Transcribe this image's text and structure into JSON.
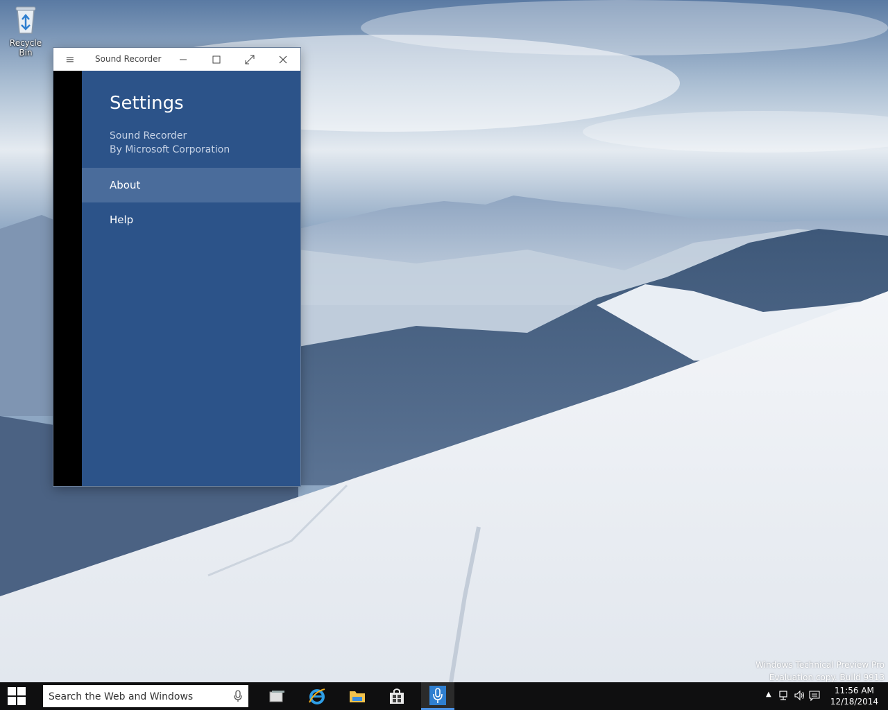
{
  "desktop": {
    "icons": [
      {
        "label": "Recycle Bin",
        "icon": "recycle-bin-icon"
      }
    ],
    "watermark": {
      "line1": "Windows Technical Preview Pro",
      "line2": "Evaluation copy. Build 9913"
    }
  },
  "window": {
    "title": "Sound Recorder",
    "controls": [
      "menu-icon",
      "minimize-icon",
      "maximize-icon",
      "fullscreen-icon",
      "close-icon"
    ],
    "settings": {
      "heading": "Settings",
      "app_name": "Sound Recorder",
      "publisher": "By Microsoft Corporation",
      "items": [
        {
          "label": "About",
          "selected": true
        },
        {
          "label": "Help",
          "selected": false
        }
      ]
    }
  },
  "taskbar": {
    "search_placeholder": "Search the Web and Windows",
    "apps": [
      "task-view-icon",
      "internet-explorer-icon",
      "file-explorer-icon",
      "store-icon",
      "sound-recorder-icon"
    ],
    "clock": {
      "time": "11:56 AM",
      "date": "12/18/2014"
    }
  },
  "colors": {
    "window_bg": "#2c5389",
    "selected_item": "#4a6c9b",
    "taskbar": "#0f0f10",
    "accent": "#4a90e2"
  }
}
